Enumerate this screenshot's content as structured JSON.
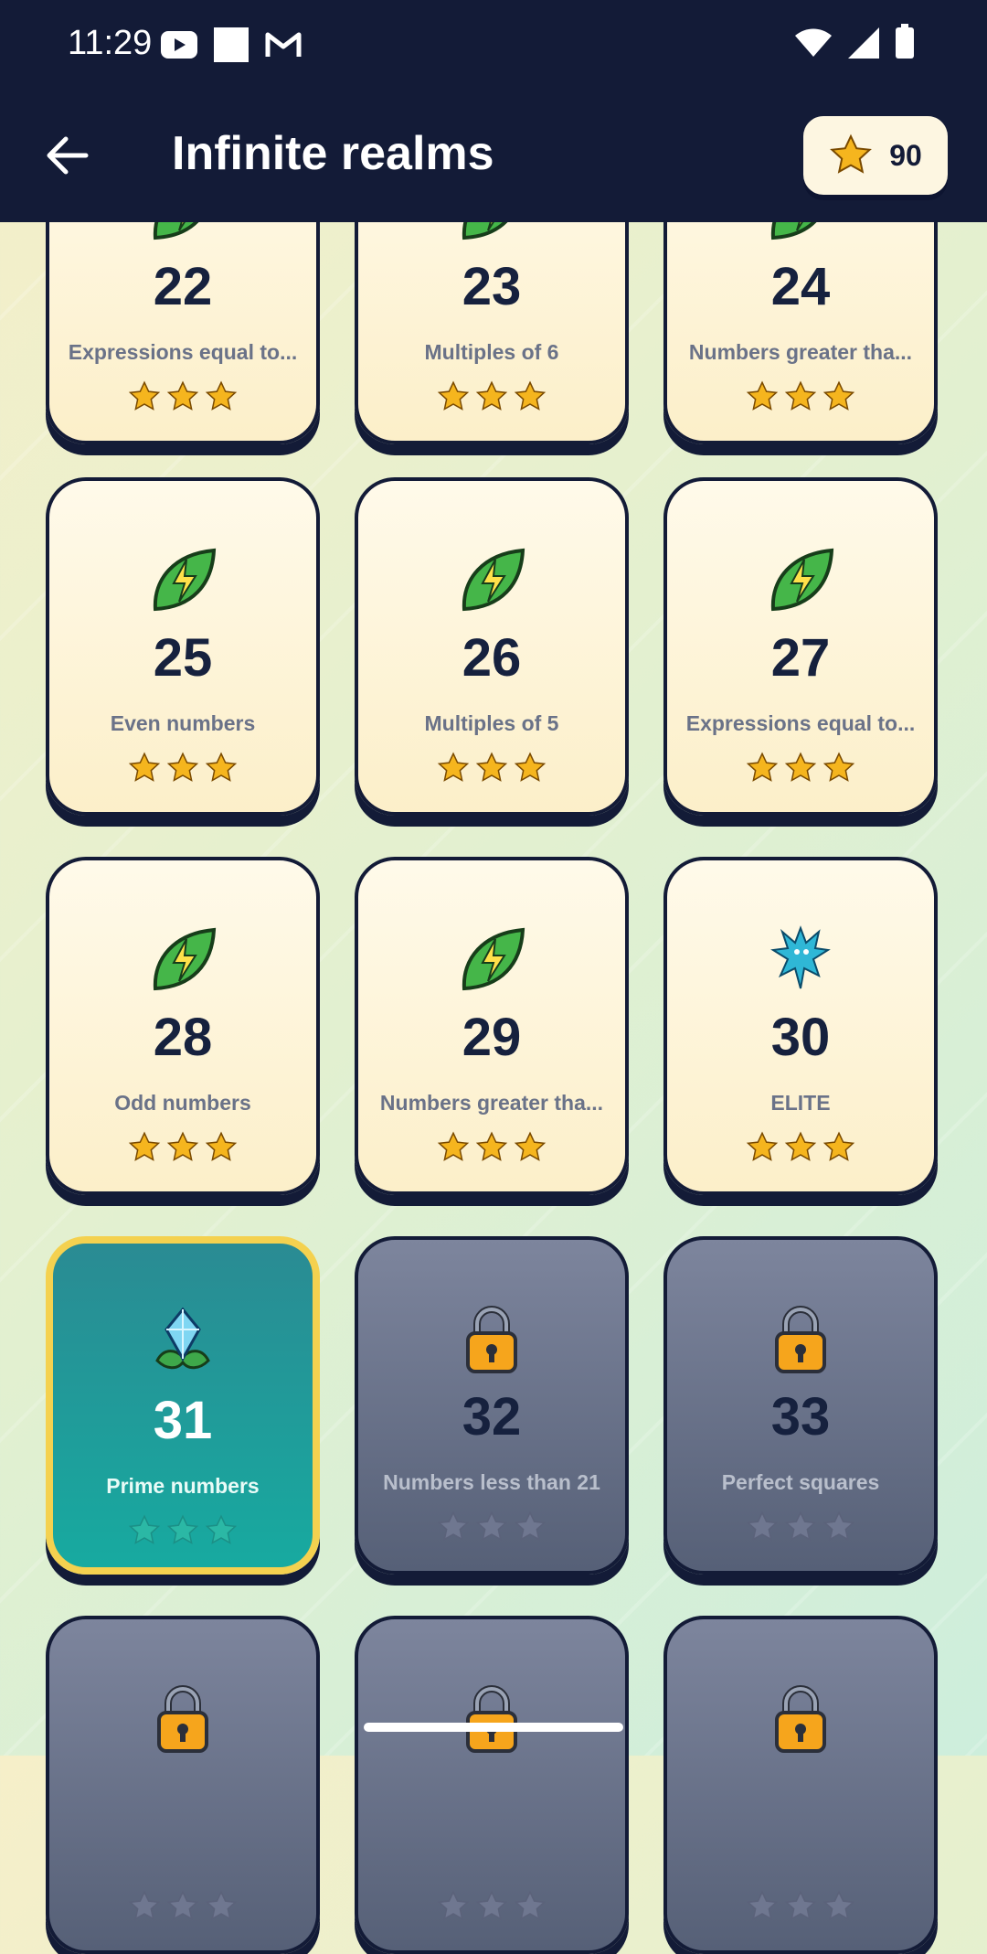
{
  "status_bar": {
    "time": "11:29"
  },
  "header": {
    "title": "Infinite realms",
    "stars_count": "90"
  },
  "colors": {
    "header_bg": "#131b37",
    "active_card": "#1fa39f",
    "locked_card": "#6b7390",
    "star_gold": "#f5b51e",
    "active_border": "#f4d14f"
  },
  "levels": [
    {
      "number": "22",
      "label": "Expressions equal to...",
      "state": "completed",
      "icon": "leaf-bolt-icon",
      "stars": 3
    },
    {
      "number": "23",
      "label": "Multiples of 6",
      "state": "completed",
      "icon": "leaf-bolt-icon",
      "stars": 3
    },
    {
      "number": "24",
      "label": "Numbers greater tha...",
      "state": "completed",
      "icon": "leaf-bolt-icon",
      "stars": 3
    },
    {
      "number": "25",
      "label": "Even numbers",
      "state": "completed",
      "icon": "leaf-bolt-icon",
      "stars": 3
    },
    {
      "number": "26",
      "label": "Multiples of 5",
      "state": "completed",
      "icon": "leaf-bolt-icon",
      "stars": 3
    },
    {
      "number": "27",
      "label": "Expressions equal to...",
      "state": "completed",
      "icon": "leaf-bolt-icon",
      "stars": 3
    },
    {
      "number": "28",
      "label": "Odd numbers",
      "state": "completed",
      "icon": "leaf-bolt-icon",
      "stars": 3
    },
    {
      "number": "29",
      "label": "Numbers greater tha...",
      "state": "completed",
      "icon": "leaf-bolt-icon",
      "stars": 3
    },
    {
      "number": "30",
      "label": "ELITE",
      "state": "completed",
      "icon": "creature-icon",
      "stars": 3
    },
    {
      "number": "31",
      "label": "Prime numbers",
      "state": "active",
      "icon": "crystal-icon",
      "stars": 0
    },
    {
      "number": "32",
      "label": "Numbers less than 21",
      "state": "locked",
      "icon": "lock-icon",
      "stars": 0
    },
    {
      "number": "33",
      "label": "Perfect squares",
      "state": "locked",
      "icon": "lock-icon",
      "stars": 0
    },
    {
      "number": "",
      "label": "",
      "state": "locked",
      "icon": "lock-icon",
      "stars": 0
    },
    {
      "number": "",
      "label": "",
      "state": "locked",
      "icon": "lock-icon",
      "stars": 0
    },
    {
      "number": "",
      "label": "",
      "state": "locked",
      "icon": "lock-icon",
      "stars": 0
    }
  ]
}
